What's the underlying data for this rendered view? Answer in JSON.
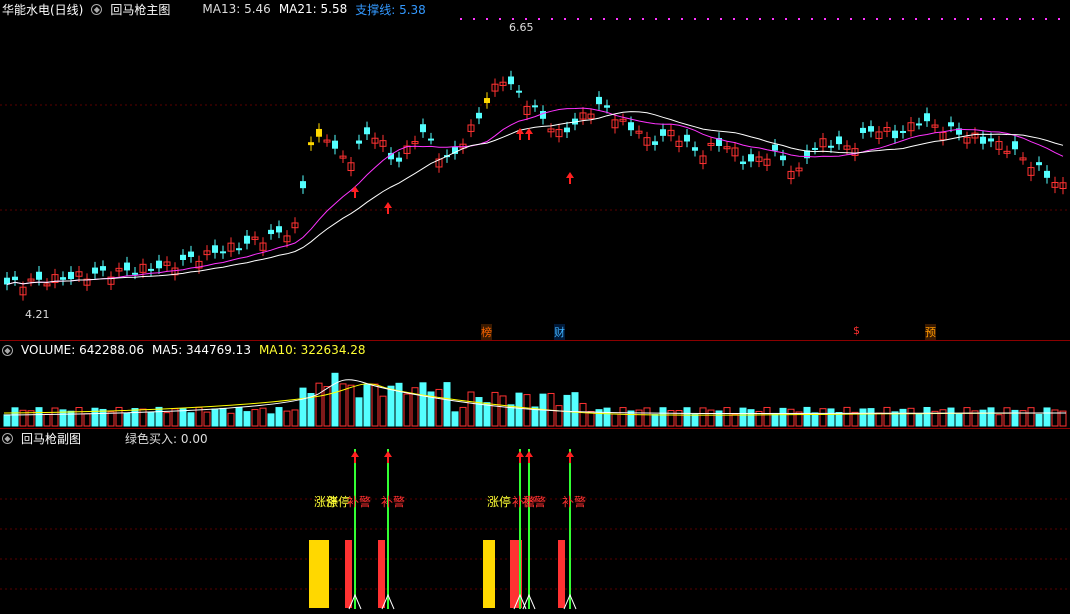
{
  "main": {
    "stock_name": "华能水电(日线)",
    "indicator_name": "回马枪主图",
    "ma13": "MA13: 5.46",
    "ma21": "MA21: 5.58",
    "support": "支撑线: 5.38",
    "high_label": "6.65",
    "low_label": "4.21",
    "markers": [
      {
        "text": "榜",
        "color": "#ff6600"
      },
      {
        "text": "财",
        "color": "#3fb3ff"
      },
      {
        "text": "$",
        "color": "#ff3030"
      },
      {
        "text": "预",
        "color": "#ff9a00"
      }
    ]
  },
  "volume": {
    "name": "VOLUME: 642288.06",
    "ma5": "MA5: 344769.13",
    "ma10": "MA10: 322634.28"
  },
  "sub": {
    "name": "回马枪副图",
    "green_buy": "绿色买入: 0.00",
    "labels": [
      {
        "text": "涨停",
        "color": "#ffff33"
      },
      {
        "text": "涨停",
        "color": "#ffff33"
      },
      {
        "text": "补警",
        "color": "#ff3030"
      },
      {
        "text": "补警",
        "color": "#ff3030"
      },
      {
        "text": "涨停",
        "color": "#ffff33"
      },
      {
        "text": "补警",
        "color": "#ff3030"
      },
      {
        "text": "补警",
        "color": "#ff3030"
      },
      {
        "text": "补警",
        "color": "#ff3030"
      }
    ]
  },
  "colors": {
    "up": "#ff3232",
    "down": "#54ffff",
    "ma_white": "#ffffff",
    "ma_magenta": "#ff33ff",
    "ma_yellow": "#ffff00",
    "limit_up": "#ffd800",
    "signal_green": "#33ff33"
  }
}
